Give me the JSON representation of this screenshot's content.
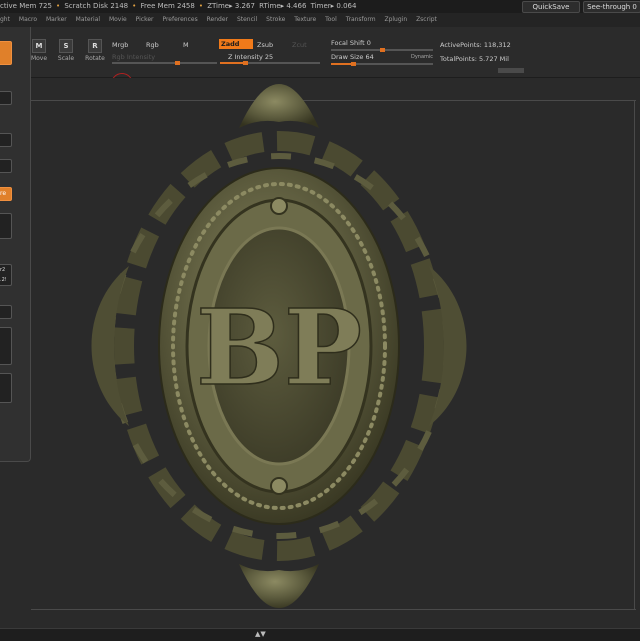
{
  "statusbar": {
    "active_mem": "ctive Mem 725",
    "scratch_disk": "Scratch Disk 2148",
    "free_mem": "Free Mem 2458",
    "ztime": "ZTime▸ 3.267",
    "rtime": "RTime▸ 4.466",
    "timer": "Timer▸ 0.064"
  },
  "top_buttons": {
    "quicksave": "QuickSave",
    "seethrough": "See-through  0"
  },
  "menus": [
    "ght",
    "Macro",
    "Marker",
    "Material",
    "Movie",
    "Picker",
    "Preferences",
    "Render",
    "Stencil",
    "Stroke",
    "Texture",
    "Tool",
    "Transform",
    "Zplugin",
    "Zscript"
  ],
  "tools": [
    {
      "label": "Move",
      "glyph": "M"
    },
    {
      "label": "Scale",
      "glyph": "S"
    },
    {
      "label": "Rotate",
      "glyph": "R"
    }
  ],
  "color_mode": {
    "mrgb": "Mrgb",
    "rgb": "Rgb",
    "m": "M",
    "rgb_intensity": "Rgb Intensity"
  },
  "z_mode": {
    "zadd": "Zadd",
    "zsub": "Zsub",
    "zcut": "Zcut",
    "z_intensity_label": "Z Intensity",
    "z_intensity_value": "25"
  },
  "focal": {
    "label": "Focal Shift",
    "value": "0"
  },
  "draw": {
    "label": "Draw Size",
    "value": "64",
    "dynamic": "Dynamic"
  },
  "sliders": {
    "rgb_intensity": 0.62,
    "z_intensity": 0.25,
    "focal_shift": 0.5,
    "draw_size": 0.22
  },
  "stats": {
    "active_label": "ActivePoints:",
    "active_value": "118,312",
    "total_label": "TotalPoints:",
    "total_value": "5.727 Mil"
  },
  "left_panel": {
    "tag1": "re",
    "tag2": "r2",
    "tag3": ".2!"
  },
  "emblem": {
    "monogram": "BP"
  },
  "colors": {
    "accent": "#f07a1a",
    "emblem": "#5d5c3e",
    "emblem_light": "#8c8a62",
    "emblem_dark": "#34331f"
  }
}
